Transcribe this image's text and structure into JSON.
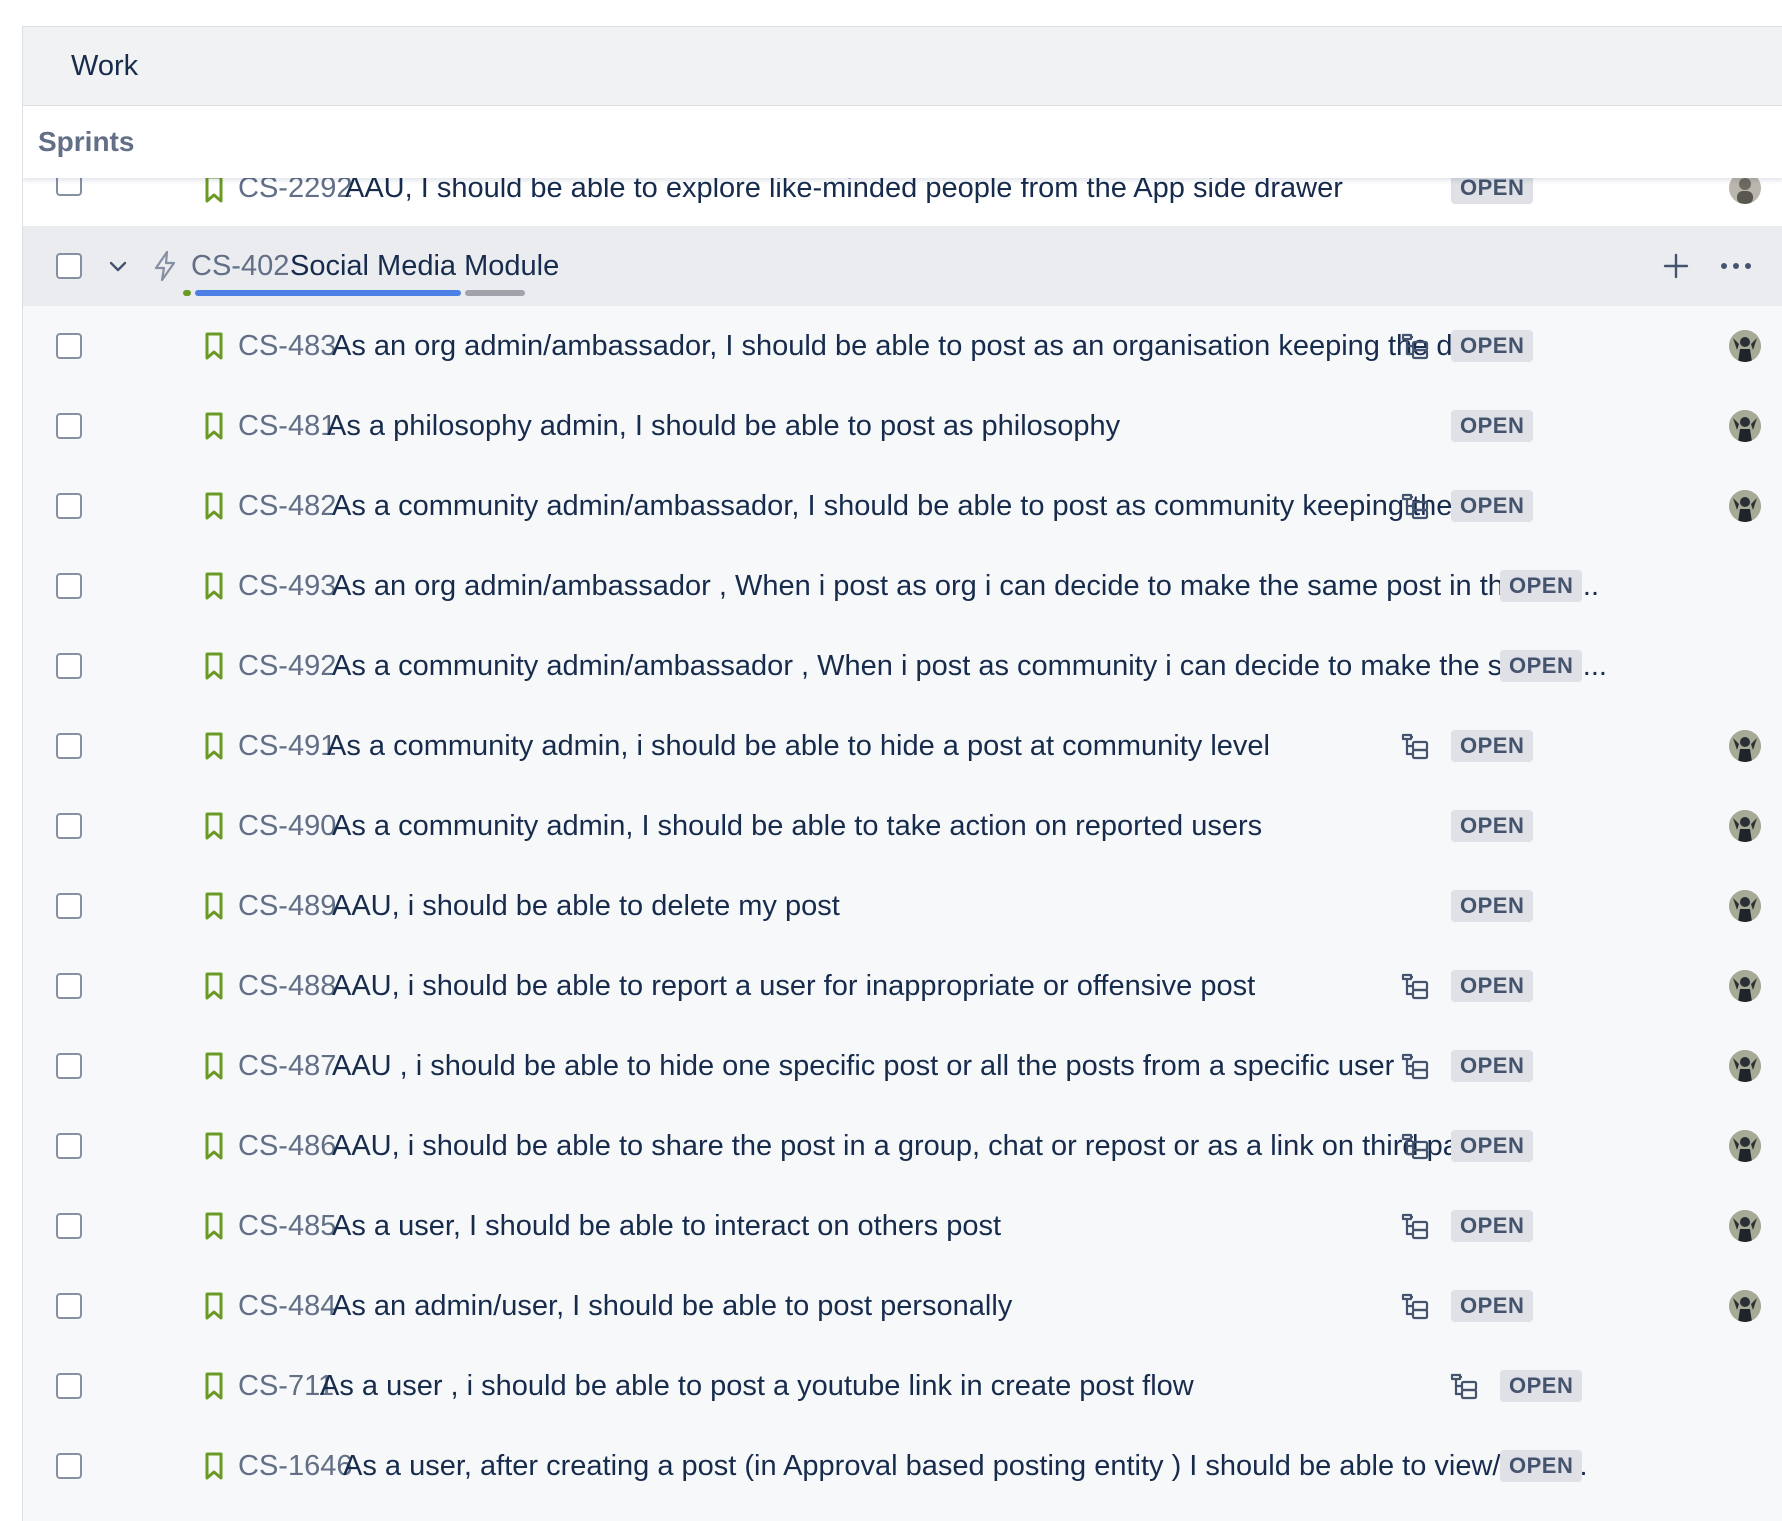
{
  "header": {
    "title": "Work"
  },
  "sprints": {
    "label": "Sprints"
  },
  "top_row": {
    "key": "CS-2292",
    "summary": "AAU, I should be able to explore like-minded people from the App side drawer",
    "status": "OPEN"
  },
  "epic": {
    "key": "CS-402",
    "summary": "Social Media Module",
    "add_label": "+",
    "more_label": "…"
  },
  "issues": [
    {
      "key": "CS-483",
      "summary": "As an org admin/ambassador, I should be able to post as an organisation keeping  the  des...",
      "status": "OPEN",
      "has_subtasks": true,
      "has_avatar": true
    },
    {
      "key": "CS-481",
      "summary": "As a philosophy admin, I should be able to post as philosophy",
      "status": "OPEN",
      "has_subtasks": false,
      "has_avatar": true
    },
    {
      "key": "CS-482",
      "summary": "As a community admin/ambassador, I should be able to post as community keeping  the  d...",
      "status": "OPEN",
      "has_subtasks": true,
      "has_avatar": true
    },
    {
      "key": "CS-493",
      "summary": "As an org admin/ambassador , When i post as org i can decide to make the same post in the inte...",
      "status": "OPEN",
      "has_subtasks": false,
      "has_avatar": false
    },
    {
      "key": "CS-492",
      "summary": "As a community admin/ambassador , When i post as community i can decide to make the same p...",
      "status": "OPEN",
      "has_subtasks": false,
      "has_avatar": false
    },
    {
      "key": "CS-491",
      "summary": "As a community admin, i should be able to hide a post at community level",
      "status": "OPEN",
      "has_subtasks": true,
      "has_avatar": true
    },
    {
      "key": "CS-490",
      "summary": "As a community admin, I should be able to take action on reported users",
      "status": "OPEN",
      "has_subtasks": false,
      "has_avatar": true
    },
    {
      "key": "CS-489",
      "summary": "AAU, i should be able to delete my post",
      "status": "OPEN",
      "has_subtasks": false,
      "has_avatar": true
    },
    {
      "key": "CS-488",
      "summary": "AAU, i should be able to report a user for inappropriate or offensive post",
      "status": "OPEN",
      "has_subtasks": true,
      "has_avatar": true
    },
    {
      "key": "CS-487",
      "summary": "AAU , i should be able to hide one specific post or all the posts from a specific user",
      "status": "OPEN",
      "has_subtasks": true,
      "has_avatar": true
    },
    {
      "key": "CS-486",
      "summary": "AAU, i should be able to share the post in a group, chat or repost or as a link on third party ...",
      "status": "OPEN",
      "has_subtasks": true,
      "has_avatar": true
    },
    {
      "key": "CS-485",
      "summary": "As a user, I should be able to interact on others post",
      "status": "OPEN",
      "has_subtasks": true,
      "has_avatar": true
    },
    {
      "key": "CS-484",
      "summary": "As an admin/user, I should be able to post personally",
      "status": "OPEN",
      "has_subtasks": true,
      "has_avatar": true
    },
    {
      "key": "CS-711",
      "summary": "As a user , i should be able to post a youtube link in create post flow",
      "status": "OPEN",
      "has_subtasks": true,
      "has_avatar": false
    },
    {
      "key": "CS-1646",
      "summary": "As a user, after creating a post (in Approval based posting entity ) I should be able to view/delet...",
      "status": "OPEN",
      "has_subtasks": false,
      "has_avatar": false
    }
  ],
  "colors": {
    "story_icon": "#6a9a23",
    "progress_in_progress": "#4c7fe4",
    "progress_done": "#6a9a23",
    "progress_todo": "#a0a4aa",
    "status_bg": "#dfe1e6"
  },
  "icons": {
    "story": "bookmark-icon",
    "epic": "lightning-icon",
    "subtasks": "subtask-tree-icon",
    "expand": "chevron-down-icon"
  }
}
